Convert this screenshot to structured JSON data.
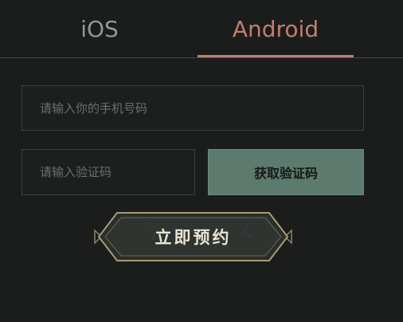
{
  "tabs": {
    "ios_label": "iOS",
    "android_label": "Android",
    "active": "Android"
  },
  "form": {
    "phone_placeholder": "请输入你的手机号码",
    "code_placeholder": "请输入验证码",
    "get_code_label": "获取验证码",
    "reserve_label": "立即预约"
  },
  "colors": {
    "background": "#1a1d1b",
    "active_tab": "#c27e6d",
    "inactive_tab": "#8b9a96",
    "button_green": "#5c7a6e",
    "frame_gold": "#a89a76"
  }
}
